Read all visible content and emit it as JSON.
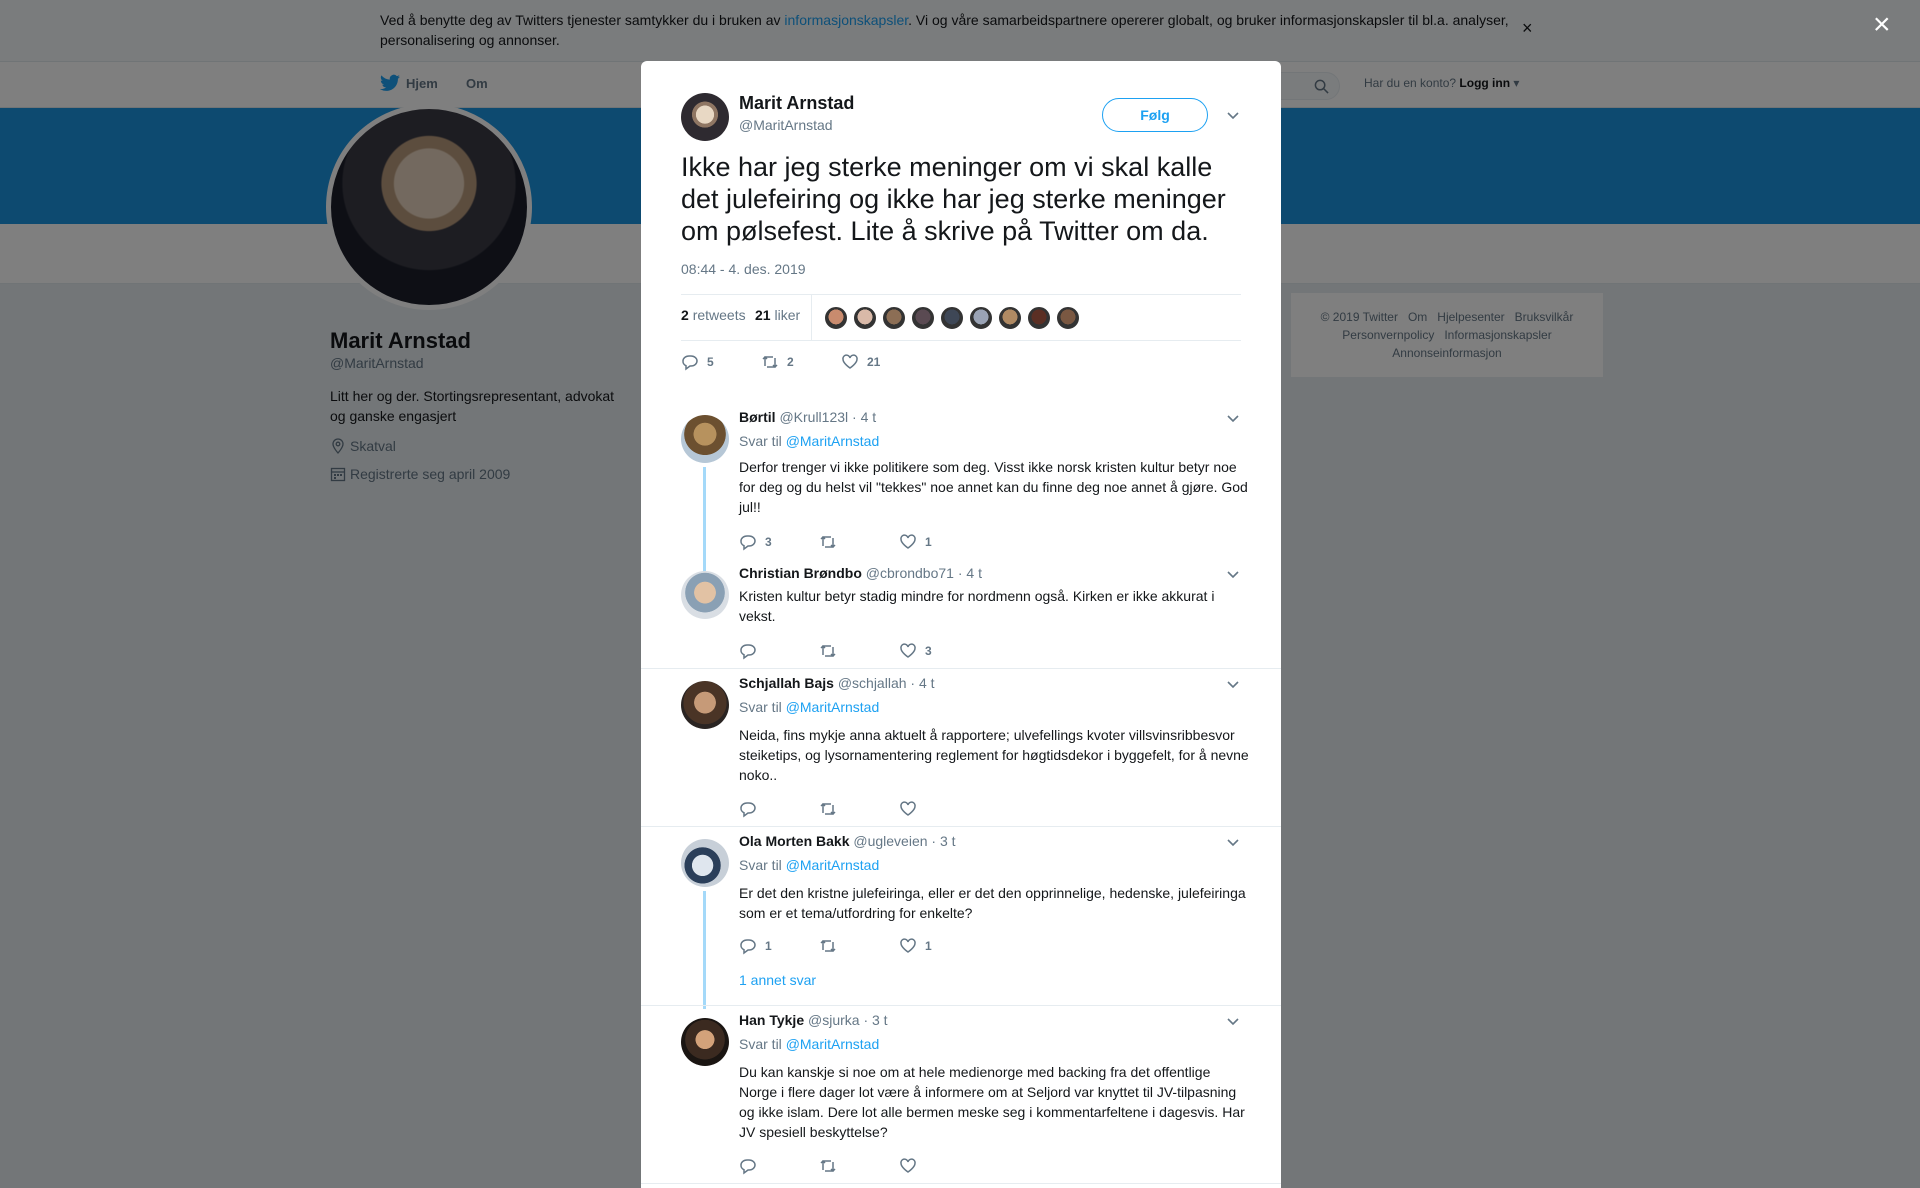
{
  "cookie": {
    "text_before": "Ved å benytte deg av Twitters tjenester samtykker du i bruken av ",
    "link": "informasjonskapsler",
    "text_after": ". Vi og våre samarbeidspartnere opererer globalt, og bruker informasjonskapsler til bl.a. analyser, personalisering og annonser.",
    "close": "×"
  },
  "nav": {
    "home": "Hjem",
    "about": "Om",
    "account_prompt": "Har du en konto?",
    "login": "Logg inn"
  },
  "profile": {
    "name": "Marit Arnstad",
    "handle": "@MaritArnstad",
    "bio": "Litt her og der. Stortingsrepresentant, advokat og ganske engasjert",
    "location": "Skatval",
    "joined": "Registrerte seg april 2009"
  },
  "footer": {
    "items": [
      "© 2019 Twitter",
      "Om",
      "Hjelpesenter",
      "Bruksvilkår",
      "Personvernpolicy",
      "Informasjonskapsler",
      "Annonseinformasjon"
    ]
  },
  "modal_close": "×",
  "tweet": {
    "name": "Marit Arnstad",
    "handle": "@MaritArnstad",
    "follow": "Følg",
    "text": "Ikke har jeg sterke meninger om vi skal kalle det julefeiring og ikke har jeg sterke meninger om pølsefest. Lite å skrive på Twitter om da.",
    "time": "08:44 - 4. des. 2019",
    "retweets_count": "2",
    "retweets_label": "retweets",
    "likes_count": "21",
    "likes_label": "liker",
    "actions": {
      "replies": "5",
      "retweets": "2",
      "likes": "21"
    },
    "liker_colors": [
      "#c98b6e",
      "#d9b9a8",
      "#8c6e55",
      "#5a4a52",
      "#3e4756",
      "#9aa3b5",
      "#b08a63",
      "#5b2f24",
      "#7a5842"
    ]
  },
  "replies": [
    {
      "name": "Børtil",
      "handle": "@Krull123l",
      "time": "· 4 t",
      "reply_to_label": "Svar til",
      "reply_to": "@MaritArnstad",
      "text": "Derfor trenger vi ikke politikere som deg. Visst ikke norsk kristen kultur betyr noe for deg og du helst vil \"tekkes\" noe annet kan du finne deg noe annet å gjøre. God jul!!",
      "replies": "3",
      "retweets": "",
      "likes": "1"
    },
    {
      "name": "Christian Brøndbo",
      "handle": "@cbrondbo71",
      "time": "· 4 t",
      "text": "Kristen kultur betyr stadig mindre for nordmenn også. Kirken er ikke akkurat i vekst.",
      "replies": "",
      "retweets": "",
      "likes": "3"
    },
    {
      "name": "Schjallah Bajs",
      "handle": "@schjallah",
      "time": "· 4 t",
      "reply_to_label": "Svar til",
      "reply_to": "@MaritArnstad",
      "text": "Neida, fins mykje anna aktuelt å rapportere; ulvefellings kvoter villsvinsribbesvor steiketips, og lysornamentering reglement for høgtidsdekor i byggefelt, for å nevne noko..",
      "replies": "",
      "retweets": "",
      "likes": ""
    },
    {
      "name": "Ola Morten Bakk",
      "handle": "@ugleveien",
      "time": "· 3 t",
      "reply_to_label": "Svar til",
      "reply_to": "@MaritArnstad",
      "text": "Er det den kristne julefeiringa, eller er det den opprinnelige, hedenske, julefeiringa som er et tema/utfordring for enkelte?",
      "replies": "1",
      "retweets": "",
      "likes": "1",
      "more": "1 annet svar"
    },
    {
      "name": "Han Tykje",
      "handle": "@sjurka",
      "time": "· 3 t",
      "reply_to_label": "Svar til",
      "reply_to": "@MaritArnstad",
      "text": "Du kan kanskje si noe om at hele medienorge med backing fra det offentlige Norge i flere dager lot være å informere om at Seljord var knyttet til JV-tilpasning og ikke islam. Dere lot alle bermen meske seg i kommentarfeltene i dagesvis. Har JV spesiell beskyttelse?",
      "replies": "",
      "retweets": "",
      "likes": ""
    }
  ]
}
